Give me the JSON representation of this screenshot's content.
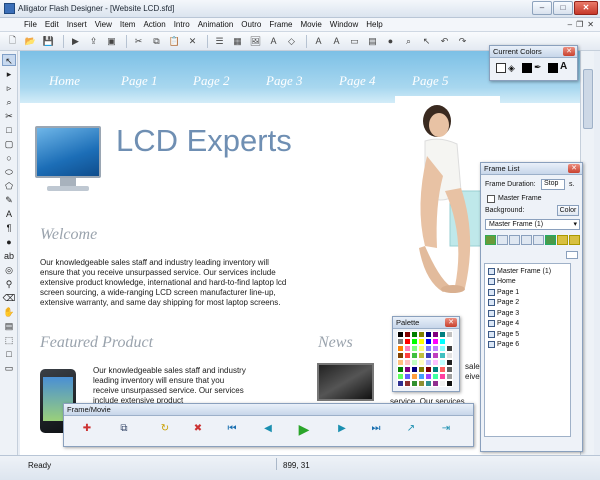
{
  "window": {
    "title": "Alligator Flash Designer - [Website LCD.sfd]"
  },
  "menubar": {
    "items": [
      "File",
      "Edit",
      "Insert",
      "View",
      "Item",
      "Action",
      "Intro",
      "Animation",
      "Outro",
      "Frame",
      "Movie",
      "Window",
      "Help"
    ]
  },
  "site": {
    "nav": [
      "Home",
      "Page 1",
      "Page 2",
      "Page 3",
      "Page 4",
      "Page 5"
    ],
    "logo": "LCD Experts",
    "welcome_heading": "Welcome",
    "welcome_text": "Our knowledgeable sales staff and industry leading inventory will ensure that you receive unsurpassed service. Our services include extensive product knowledge, international and hard-to-find laptop lcd screen sourcing, a wide-ranging LCD screen manufacturer line-up, extensive warranty, and same day shipping for most laptop screens.",
    "featured_heading": "Featured Product",
    "featured_text": "Our knowledgeable sales staff and industry leading inventory will ensure that you receive unsurpassed service. Our services include extensive product",
    "news_heading": "News",
    "news_text_1": "sale",
    "news_text_2": "eive",
    "news_text_3": "service. Our services"
  },
  "current_colors": {
    "title": "Current Colors"
  },
  "frame_list": {
    "title": "Frame List",
    "duration_label": "Frame Duration:",
    "duration_value": "Stop",
    "duration_unit": "s.",
    "master_frame_label": "Master Frame",
    "background_label": "Background:",
    "color_button": "Color",
    "selected_frame": "Master Frame (1)",
    "frames": [
      "Master Frame (1)",
      "Home",
      "Page 1",
      "Page 2",
      "Page 3",
      "Page 4",
      "Page 5",
      "Page 6"
    ]
  },
  "palette": {
    "title": "Palette",
    "colors": [
      "#000000",
      "#7f0000",
      "#007f00",
      "#7f7f00",
      "#00007f",
      "#7f007f",
      "#007f7f",
      "#c0c0c0",
      "#808080",
      "#ff0000",
      "#00ff00",
      "#ffff00",
      "#0000ff",
      "#ff00ff",
      "#00ffff",
      "#ffffff",
      "#ff8000",
      "#ff80c0",
      "#80ff80",
      "#ffff80",
      "#8080ff",
      "#c080ff",
      "#80ffff",
      "#404040",
      "#804000",
      "#ff4040",
      "#40c040",
      "#c0c040",
      "#4040c0",
      "#c040c0",
      "#40c0c0",
      "#e0e0e0",
      "#ffc080",
      "#ffc0c0",
      "#c0ffc0",
      "#ffffc0",
      "#c0c0ff",
      "#ffc0ff",
      "#c0ffff",
      "#202020",
      "#008000",
      "#800080",
      "#000080",
      "#808000",
      "#800000",
      "#008080",
      "#ff6060",
      "#606060",
      "#60ff60",
      "#6060ff",
      "#ffa040",
      "#40a0ff",
      "#a040ff",
      "#40ffa0",
      "#ff40a0",
      "#a0a0a0",
      "#303090",
      "#903030",
      "#309030",
      "#909030",
      "#309090",
      "#903090",
      "#f0f0f0",
      "#101010"
    ]
  },
  "frame_movie": {
    "title": "Frame/Movie"
  },
  "status": {
    "left": "Ready",
    "coords": "899, 31"
  }
}
